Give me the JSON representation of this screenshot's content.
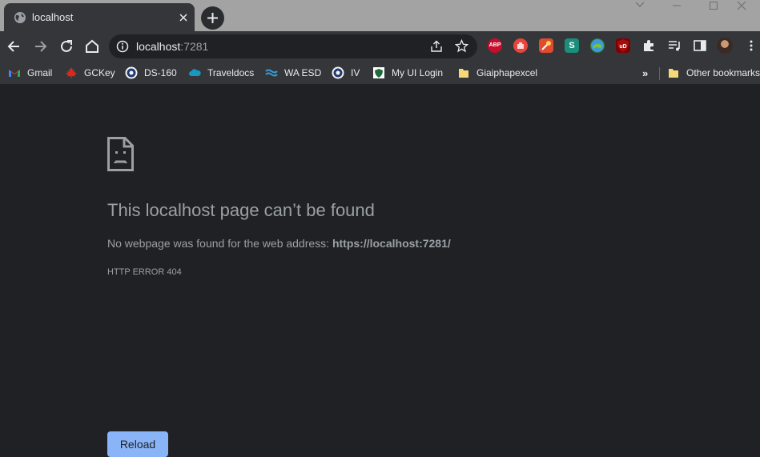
{
  "tab": {
    "title": "localhost"
  },
  "omnibox": {
    "host": "localhost",
    "port": ":7281"
  },
  "bookmarks": {
    "items": [
      {
        "label": "Gmail",
        "icon": "gmail-icon"
      },
      {
        "label": "GCKey",
        "icon": "maple-leaf-icon"
      },
      {
        "label": "DS-160",
        "icon": "state-seal-icon"
      },
      {
        "label": "Traveldocs",
        "icon": "cloud-icon"
      },
      {
        "label": "WA ESD",
        "icon": "wave-icon"
      },
      {
        "label": "IV",
        "icon": "state-seal-icon"
      },
      {
        "label": "My UI Login",
        "icon": "shield-icon"
      },
      {
        "label": "Giaiphapexcel",
        "icon": "folder-icon"
      }
    ],
    "more": "»",
    "other": "Other bookmarks"
  },
  "error": {
    "title": "This localhost page can’t be found",
    "desc_prefix": "No webpage was found for the web address: ",
    "desc_url": "https://localhost:7281/",
    "code": "HTTP ERROR 404",
    "reload_label": "Reload"
  },
  "colors": {
    "page_bg": "#202124",
    "toolbar_bg": "#35363a",
    "reload_button": "#8ab4f8",
    "muted_text": "#9aa0a6"
  }
}
